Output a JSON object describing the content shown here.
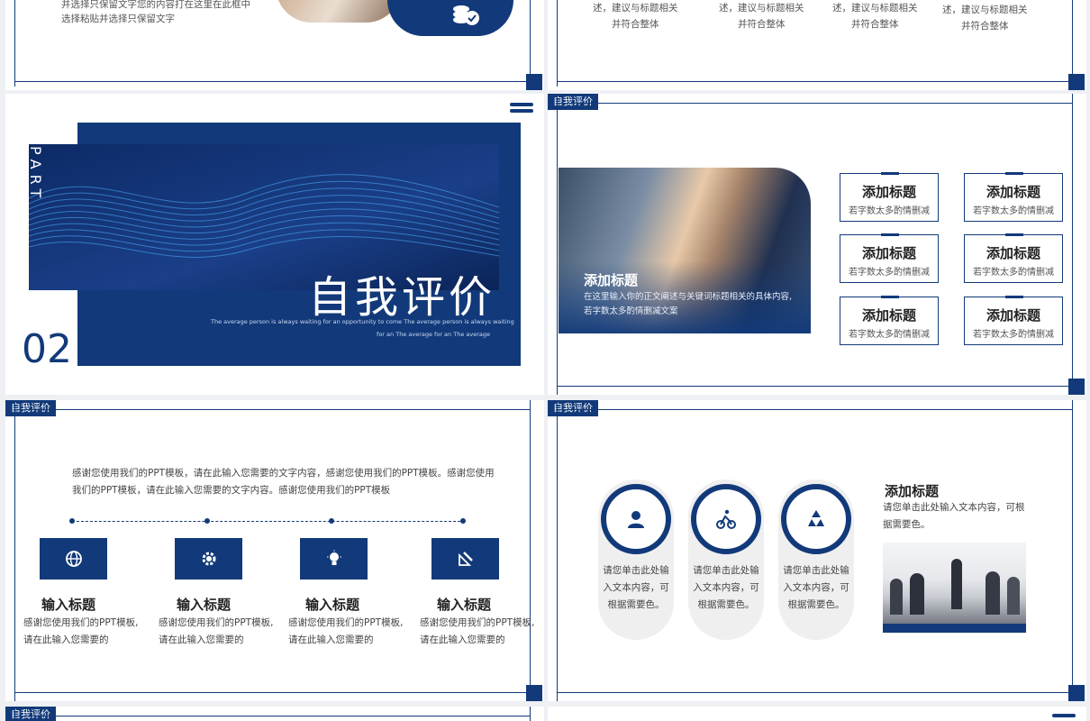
{
  "top_left": {
    "line1": "并选择只保留文字您的内容打在这里在此框中",
    "line2": "选择粘贴并选择只保留文字"
  },
  "top_right": {
    "cols": [
      {
        "l1": "述，建议与标题相关",
        "l2": "并符合整体"
      },
      {
        "l1": "述，建议与标题相关",
        "l2": "并符合整体"
      },
      {
        "l1": "述，建议与标题相关",
        "l2": "并符合整体"
      },
      {
        "l1": "述，建议与标题相关",
        "l2": "并符合整体"
      }
    ]
  },
  "section_slide": {
    "part_label": "PART",
    "number": "02",
    "title": "自我评价",
    "sub1": "The average person is always waiting for an opportunity to come The average person is always waiting",
    "sub2": "for an The average for an The average"
  },
  "slide_grid": {
    "tag": "自我评价",
    "photo_title": "添加标题",
    "photo_text1": "在这里输入你的正文阐述与关键词标题相关的具体内容,",
    "photo_text2": "若字数太多酌情删减文案",
    "boxes": [
      {
        "title": "添加标题",
        "sub": "若字数太多酌情删减"
      },
      {
        "title": "添加标题",
        "sub": "若字数太多酌情删减"
      },
      {
        "title": "添加标题",
        "sub": "若字数太多酌情删减"
      },
      {
        "title": "添加标题",
        "sub": "若字数太多酌情删减"
      },
      {
        "title": "添加标题",
        "sub": "若字数太多酌情删减"
      },
      {
        "title": "添加标题",
        "sub": "若字数太多酌情删减"
      }
    ]
  },
  "slide_timeline": {
    "tag": "自我评价",
    "intro1": "感谢您使用我们的PPT模板，请在此输入您需要的文字内容，感谢您使用我们的PPT模板。感谢您使用",
    "intro2": "我们的PPT模板，请在此输入您需要的文字内容。感谢您使用我们的PPT模板",
    "items": [
      {
        "icon": "globe-icon",
        "title": "输入标题",
        "d1": "感谢您使用我们的PPT模板,",
        "d2": "请在此输入您需要的"
      },
      {
        "icon": "gear-icon",
        "title": "输入标题",
        "d1": "感谢您使用我们的PPT模板,",
        "d2": "请在此输入您需要的"
      },
      {
        "icon": "lightbulb-icon",
        "title": "输入标题",
        "d1": "感谢您使用我们的PPT模板,",
        "d2": "请在此输入您需要的"
      },
      {
        "icon": "ruler-pencil-icon",
        "title": "输入标题",
        "d1": "感谢您使用我们的PPT模板,",
        "d2": "请在此输入您需要的"
      }
    ]
  },
  "slide_circles": {
    "tag": "自我评价",
    "pills": [
      {
        "icon": "user-icon",
        "l1": "请您单击此处输",
        "l2": "入文本内容，可",
        "l3": "根据需要色。"
      },
      {
        "icon": "cycling-icon",
        "l1": "请您单击此处输",
        "l2": "入文本内容，可",
        "l3": "根据需要色。"
      },
      {
        "icon": "recycle-icon",
        "l1": "请您单击此处输",
        "l2": "入文本内容，可",
        "l3": "根据需要色。"
      }
    ],
    "title": "添加标题",
    "d1": "请您单击此处输入文本内容，可根",
    "d2": "据需要色。"
  },
  "bottom": {
    "tag": "自我评价"
  },
  "colors": {
    "navy": "#123a7a",
    "light_navy": "#2b5aa8"
  }
}
